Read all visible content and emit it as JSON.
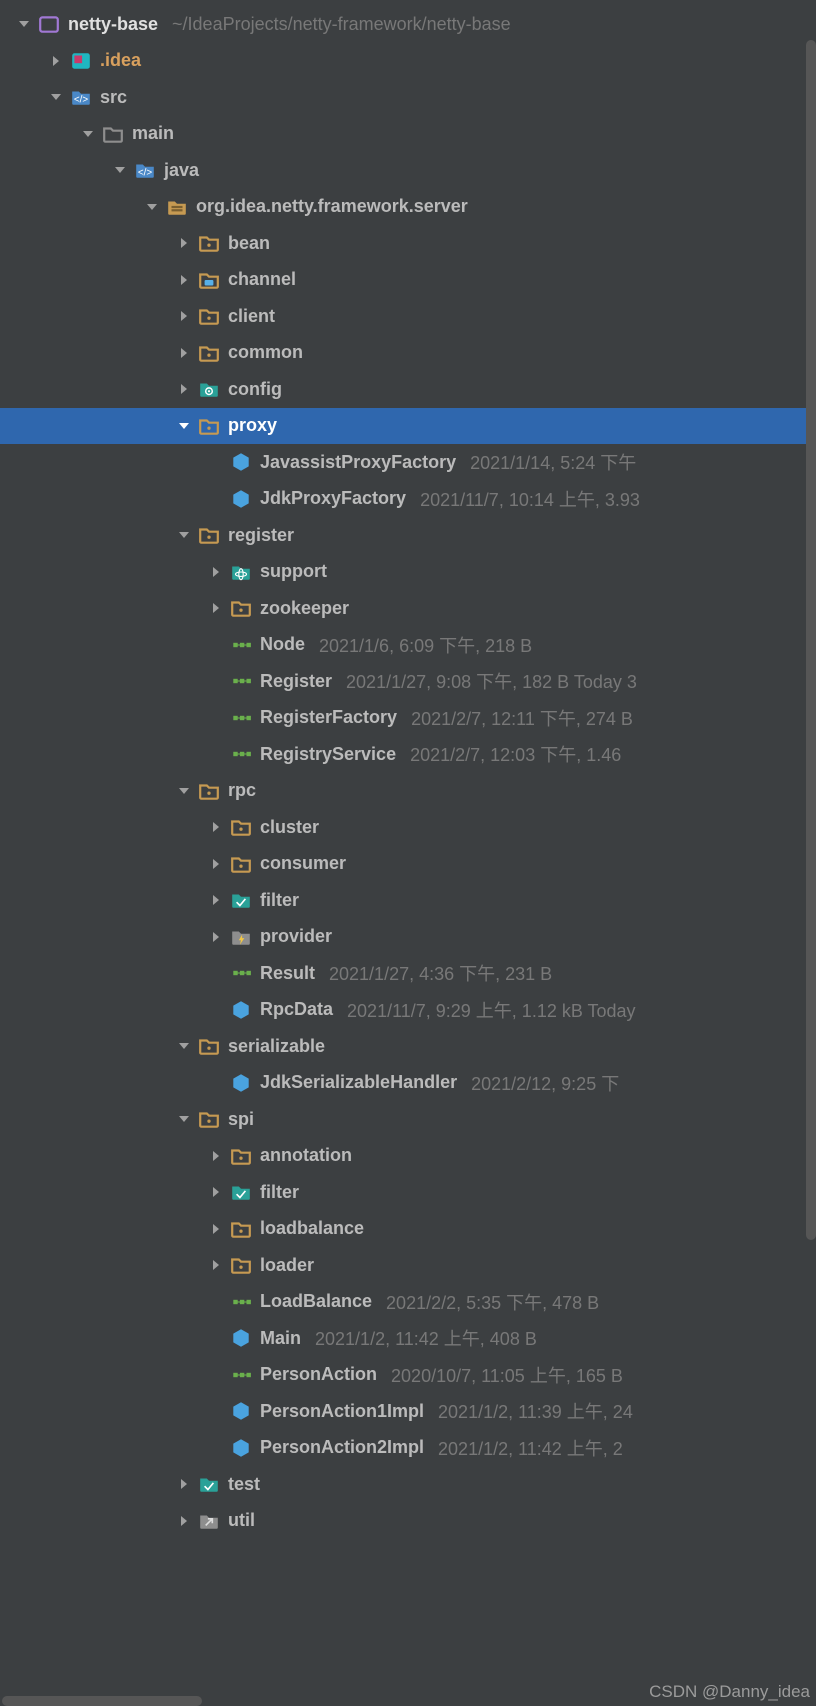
{
  "watermark": "CSDN @Danny_idea",
  "tree": [
    {
      "depth": 0,
      "arrow": "down",
      "icon": "module",
      "label": "netty-base",
      "meta": "~/IdeaProjects/netty-framework/netty-base",
      "labelClass": "root-label"
    },
    {
      "depth": 1,
      "arrow": "right",
      "icon": "idea",
      "label": ".idea",
      "labelClass": "idea-label"
    },
    {
      "depth": 1,
      "arrow": "down",
      "icon": "src",
      "label": "src"
    },
    {
      "depth": 2,
      "arrow": "down",
      "icon": "folder-gray",
      "label": "main"
    },
    {
      "depth": 3,
      "arrow": "down",
      "icon": "src",
      "label": "java"
    },
    {
      "depth": 4,
      "arrow": "down",
      "icon": "package",
      "label": "org.idea.netty.framework.server"
    },
    {
      "depth": 5,
      "arrow": "right",
      "icon": "folder",
      "label": "bean"
    },
    {
      "depth": 5,
      "arrow": "right",
      "icon": "folder-channel",
      "label": "channel"
    },
    {
      "depth": 5,
      "arrow": "right",
      "icon": "folder",
      "label": "client"
    },
    {
      "depth": 5,
      "arrow": "right",
      "icon": "folder",
      "label": "common"
    },
    {
      "depth": 5,
      "arrow": "right",
      "icon": "folder-teal-gear",
      "label": "config"
    },
    {
      "depth": 5,
      "arrow": "down",
      "icon": "folder",
      "label": "proxy",
      "selected": true
    },
    {
      "depth": 6,
      "arrow": "none",
      "icon": "class",
      "label": "JavassistProxyFactory",
      "meta": "2021/1/14, 5:24 下午"
    },
    {
      "depth": 6,
      "arrow": "none",
      "icon": "class",
      "label": "JdkProxyFactory",
      "meta": "2021/11/7, 10:14 上午, 3.93"
    },
    {
      "depth": 5,
      "arrow": "down",
      "icon": "folder",
      "label": "register"
    },
    {
      "depth": 6,
      "arrow": "right",
      "icon": "folder-teal-atom",
      "label": "support"
    },
    {
      "depth": 6,
      "arrow": "right",
      "icon": "folder",
      "label": "zookeeper"
    },
    {
      "depth": 6,
      "arrow": "none",
      "icon": "interface",
      "label": "Node",
      "meta": "2021/1/6, 6:09 下午, 218 B"
    },
    {
      "depth": 6,
      "arrow": "none",
      "icon": "interface",
      "label": "Register",
      "meta": "2021/1/27, 9:08 下午, 182 B Today 3"
    },
    {
      "depth": 6,
      "arrow": "none",
      "icon": "interface",
      "label": "RegisterFactory",
      "meta": "2021/2/7, 12:11 下午, 274 B"
    },
    {
      "depth": 6,
      "arrow": "none",
      "icon": "interface",
      "label": "RegistryService",
      "meta": "2021/2/7, 12:03 下午, 1.46"
    },
    {
      "depth": 5,
      "arrow": "down",
      "icon": "folder",
      "label": "rpc"
    },
    {
      "depth": 6,
      "arrow": "right",
      "icon": "folder",
      "label": "cluster"
    },
    {
      "depth": 6,
      "arrow": "right",
      "icon": "folder",
      "label": "consumer"
    },
    {
      "depth": 6,
      "arrow": "right",
      "icon": "folder-teal",
      "label": "filter"
    },
    {
      "depth": 6,
      "arrow": "right",
      "icon": "folder-gray-lightning",
      "label": "provider"
    },
    {
      "depth": 6,
      "arrow": "none",
      "icon": "interface",
      "label": "Result",
      "meta": "2021/1/27, 4:36 下午, 231 B"
    },
    {
      "depth": 6,
      "arrow": "none",
      "icon": "class",
      "label": "RpcData",
      "meta": "2021/11/7, 9:29 上午, 1.12 kB Today"
    },
    {
      "depth": 5,
      "arrow": "down",
      "icon": "folder",
      "label": "serializable"
    },
    {
      "depth": 6,
      "arrow": "none",
      "icon": "class",
      "label": "JdkSerializableHandler",
      "meta": "2021/2/12, 9:25 下"
    },
    {
      "depth": 5,
      "arrow": "down",
      "icon": "folder",
      "label": "spi"
    },
    {
      "depth": 6,
      "arrow": "right",
      "icon": "folder",
      "label": "annotation"
    },
    {
      "depth": 6,
      "arrow": "right",
      "icon": "folder-teal",
      "label": "filter"
    },
    {
      "depth": 6,
      "arrow": "right",
      "icon": "folder",
      "label": "loadbalance"
    },
    {
      "depth": 6,
      "arrow": "right",
      "icon": "folder",
      "label": "loader"
    },
    {
      "depth": 6,
      "arrow": "none",
      "icon": "interface",
      "label": "LoadBalance",
      "meta": "2021/2/2, 5:35 下午, 478 B"
    },
    {
      "depth": 6,
      "arrow": "none",
      "icon": "class",
      "label": "Main",
      "meta": "2021/1/2, 11:42 上午, 408 B"
    },
    {
      "depth": 6,
      "arrow": "none",
      "icon": "interface",
      "label": "PersonAction",
      "meta": "2020/10/7, 11:05 上午, 165 B"
    },
    {
      "depth": 6,
      "arrow": "none",
      "icon": "class",
      "label": "PersonAction1Impl",
      "meta": "2021/1/2, 11:39 上午, 24"
    },
    {
      "depth": 6,
      "arrow": "none",
      "icon": "class",
      "label": "PersonAction2Impl",
      "meta": "2021/1/2, 11:42 上午, 2"
    },
    {
      "depth": 5,
      "arrow": "right",
      "icon": "folder-teal",
      "label": "test"
    },
    {
      "depth": 5,
      "arrow": "right",
      "icon": "folder-gray-util",
      "label": "util"
    }
  ]
}
